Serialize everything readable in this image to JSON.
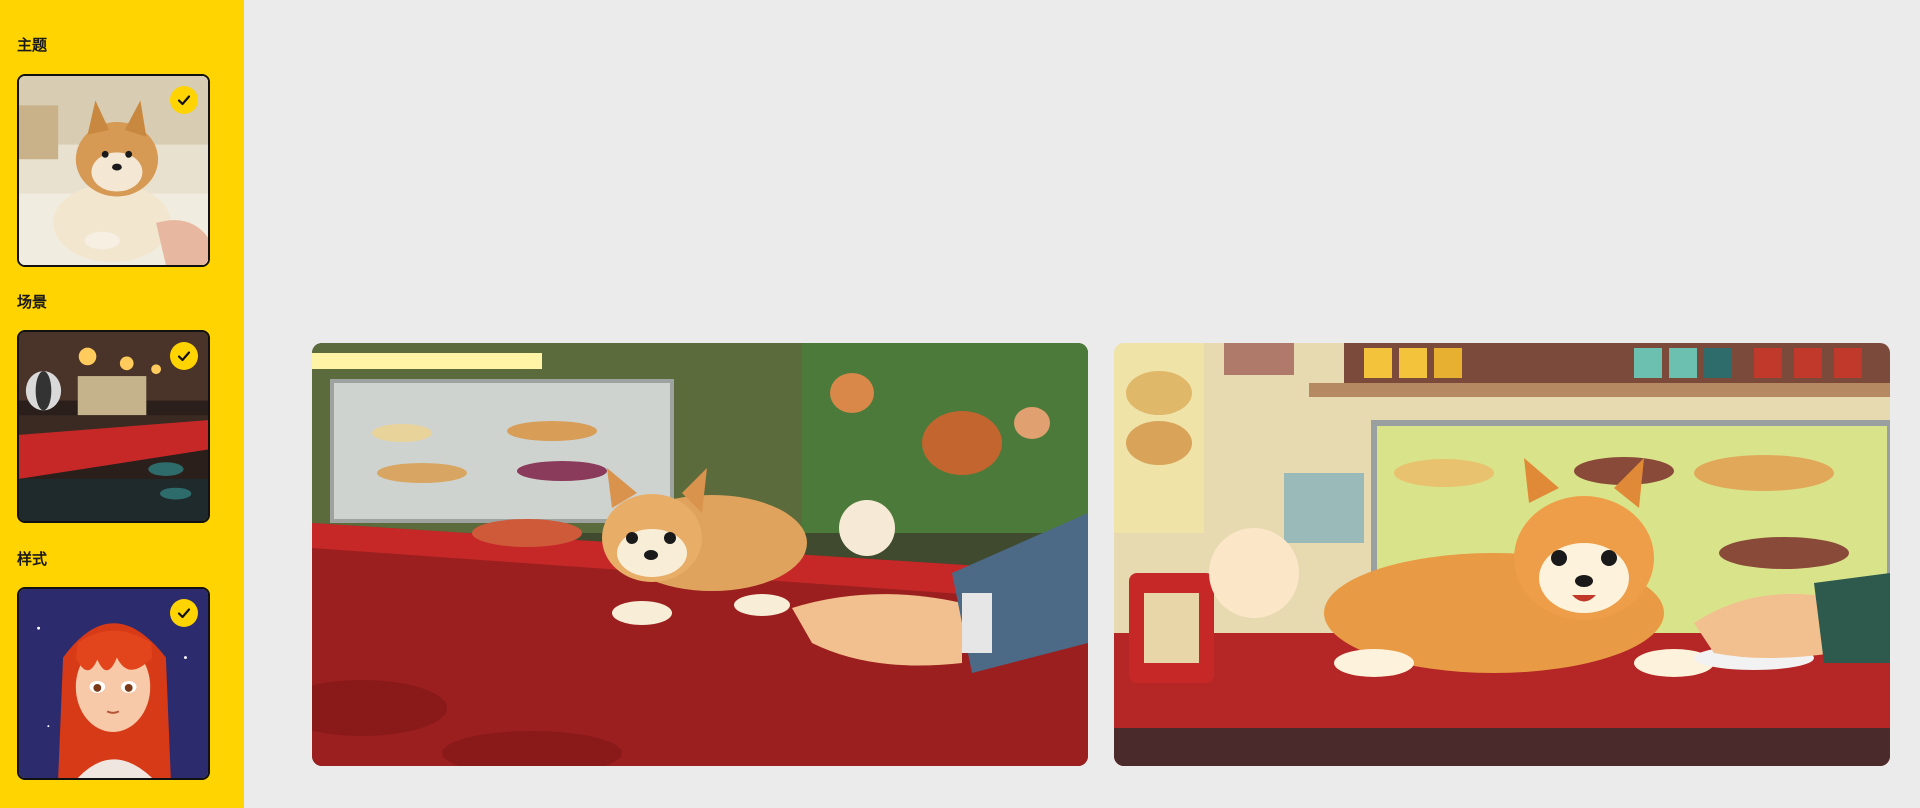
{
  "sidebar": {
    "sections": [
      {
        "label": "主题",
        "thumbnail": "shiba-inu-photo",
        "selected": true
      },
      {
        "label": "场景",
        "thumbnail": "retro-diner-scene",
        "selected": true
      },
      {
        "label": "样式",
        "thumbnail": "anime-redhead-portrait",
        "selected": true
      }
    ]
  },
  "results": [
    {
      "image": "anime-shiba-on-diner-counter-with-hand"
    },
    {
      "image": "anime-shiba-on-diner-counter-with-pies"
    }
  ],
  "colors": {
    "sidebar_bg": "#ffd400",
    "canvas_bg": "#ebebeb",
    "check_badge": "#ffd400"
  }
}
